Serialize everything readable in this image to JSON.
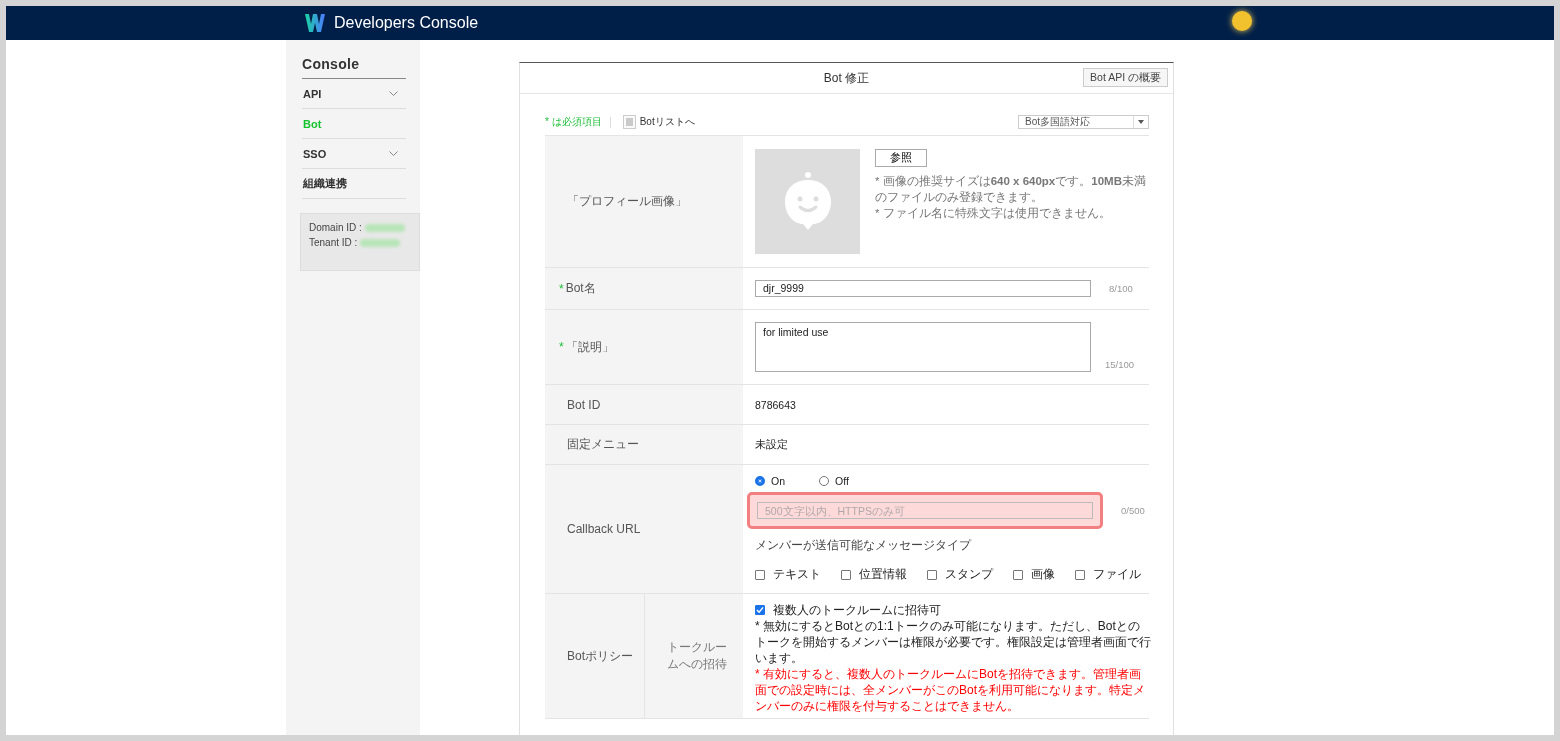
{
  "header": {
    "title": "Developers Console"
  },
  "sidebar": {
    "title": "Console",
    "items": [
      {
        "label": "API",
        "selected": false,
        "expandable": true
      },
      {
        "label": "Bot",
        "selected": true,
        "expandable": false
      },
      {
        "label": "SSO",
        "selected": false,
        "expandable": true
      },
      {
        "label": "組織連携",
        "selected": false,
        "expandable": false
      }
    ],
    "info": [
      {
        "label": "Domain ID :"
      },
      {
        "label": "Tenant ID :"
      }
    ]
  },
  "page": {
    "title": "Bot 修正",
    "overview_button": "Bot API の概要",
    "required_note": "* は必須項目",
    "list_link": "Botリストへ",
    "language_select": "Bot多国語対応"
  },
  "form": [
    {
      "kind": "image",
      "label": "「プロフィール画像」",
      "button": "参照",
      "notes": [
        "* 画像の推奨サイズは**640 x 640px**です。**10MB**未満のファイルのみ登録できます。",
        "* ファイル名に特殊文字は使用できません。"
      ]
    },
    {
      "kind": "input",
      "mark": "*",
      "label": "Bot名",
      "value": "djr_9999",
      "count": "8/100"
    },
    {
      "kind": "textarea",
      "mark": "*",
      "label": "「説明」",
      "value": "for limited use",
      "count": "15/100"
    },
    {
      "kind": "static",
      "label": "Bot ID",
      "value": "8786643"
    },
    {
      "kind": "static",
      "label": "固定メニュー",
      "value": "未設定"
    },
    {
      "kind": "callback",
      "label": "Callback URL",
      "options": [
        {
          "label": "On",
          "selected": true
        },
        {
          "label": "Off",
          "selected": false
        }
      ],
      "placeholder": "500文字以内、HTTPSのみ可",
      "count": "0/500",
      "highlighted": true,
      "types_label": "メンバーが送信可能なメッセージタイプ",
      "types": [
        {
          "label": "テキスト",
          "checked": false
        },
        {
          "label": "位置情報",
          "checked": false
        },
        {
          "label": "スタンプ",
          "checked": false
        },
        {
          "label": "画像",
          "checked": false
        },
        {
          "label": "ファイル",
          "checked": false
        }
      ]
    },
    {
      "kind": "policy",
      "label": "Botポリシー",
      "sublabel": "トークルームへの招待",
      "option": {
        "label": "複数人のトークルームに招待可",
        "checked": true
      },
      "note": "* 無効にするとBotとの1:1トークのみ可能になります。ただし、Botとのトークを開始するメンバーは権限が必要です。権限設定は管理者画面で行います。",
      "warning": "* 有効にすると、複数人のトークルームにBotを招待できます。管理者画面での設定時には、全メンバーがこのBotを利用可能になります。特定メンバーのみに権限を付与することはできません。"
    }
  ]
}
